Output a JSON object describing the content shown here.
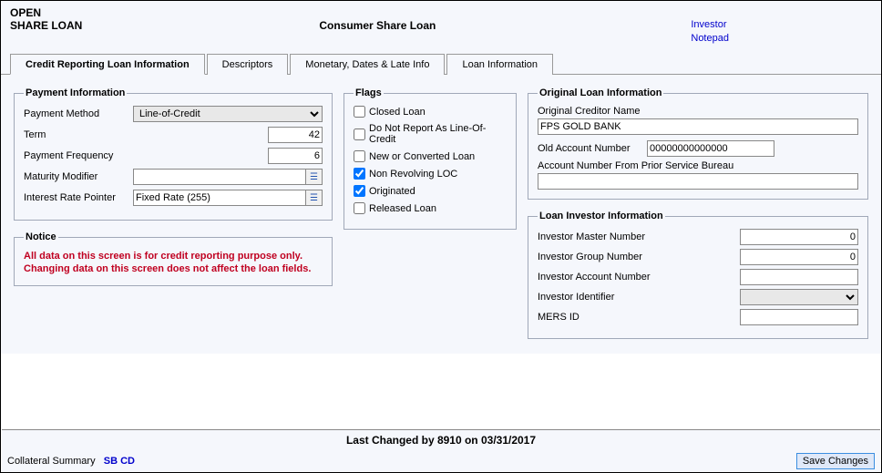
{
  "header": {
    "status": "OPEN",
    "loan_type_label": "SHARE LOAN",
    "title": "Consumer Share Loan",
    "links": {
      "investor": "Investor",
      "notepad": "Notepad"
    }
  },
  "tabs": {
    "t1": "Credit Reporting Loan Information",
    "t2": "Descriptors",
    "t3": "Monetary, Dates & Late Info",
    "t4": "Loan Information"
  },
  "payment_info": {
    "legend": "Payment Information",
    "payment_method_label": "Payment Method",
    "payment_method_value": "Line-of-Credit",
    "term_label": "Term",
    "term_value": "42",
    "frequency_label": "Payment Frequency",
    "frequency_value": "6",
    "maturity_label": "Maturity Modifier",
    "maturity_value": "",
    "rate_pointer_label": "Interest Rate Pointer",
    "rate_pointer_value": "Fixed Rate (255)"
  },
  "notice": {
    "legend": "Notice",
    "text": "All data on this screen is for credit reporting purpose only.  Changing data on this screen does not affect the loan fields."
  },
  "flags": {
    "legend": "Flags",
    "closed_loan": "Closed Loan",
    "do_not_report": "Do Not Report As Line-Of-Credit",
    "new_converted": "New or Converted Loan",
    "non_revolving": "Non Revolving LOC",
    "originated": "Originated",
    "released": "Released Loan"
  },
  "original": {
    "legend": "Original Loan Information",
    "creditor_label": "Original Creditor Name",
    "creditor_value": "FPS GOLD BANK",
    "old_acct_label": "Old Account Number",
    "old_acct_value": "00000000000000",
    "prior_bureau_label": "Account Number From Prior Service Bureau",
    "prior_bureau_value": ""
  },
  "investor": {
    "legend": "Loan Investor Information",
    "master_label": "Investor Master Number",
    "master_value": "0",
    "group_label": "Investor Group Number",
    "group_value": "0",
    "acct_label": "Investor Account Number",
    "acct_value": "",
    "identifier_label": "Investor Identifier",
    "identifier_value": "",
    "mers_label": "MERS ID",
    "mers_value": ""
  },
  "footer": {
    "last_changed": "Last Changed by 8910 on 03/31/2017",
    "collateral_label": "Collateral Summary",
    "sbcd": "SB CD",
    "save": "Save Changes"
  }
}
